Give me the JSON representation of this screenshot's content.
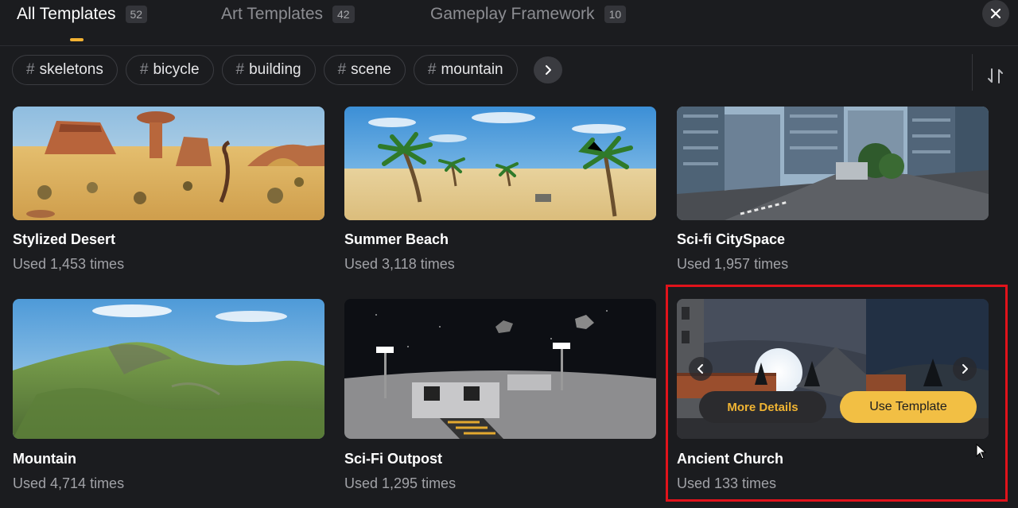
{
  "tabs": [
    {
      "label": "All Templates",
      "count": "52",
      "active": true
    },
    {
      "label": "Art Templates",
      "count": "42",
      "active": false
    },
    {
      "label": "Gameplay Framework",
      "count": "10",
      "active": false
    }
  ],
  "accent_color": "#f2b233",
  "tags": [
    {
      "hash": "#",
      "label": "skeletons"
    },
    {
      "hash": "#",
      "label": "bicycle"
    },
    {
      "hash": "#",
      "label": "building"
    },
    {
      "hash": "#",
      "label": "scene"
    },
    {
      "hash": "#",
      "label": "mountain"
    }
  ],
  "icons": {
    "close": "close-icon",
    "tags_next": "chevron-right-icon",
    "sort": "sort-icon",
    "carousel_prev": "chevron-left-icon",
    "carousel_next": "chevron-right-icon"
  },
  "templates": [
    {
      "title": "Stylized Desert",
      "usage": "Used 1,453 times"
    },
    {
      "title": "Summer Beach",
      "usage": "Used 3,118 times"
    },
    {
      "title": "Sci-fi CitySpace",
      "usage": "Used 1,957 times"
    },
    {
      "title": "Mountain",
      "usage": "Used 4,714 times"
    },
    {
      "title": "Sci-Fi Outpost",
      "usage": "Used 1,295 times"
    },
    {
      "title": "Ancient Church",
      "usage": "Used 133 times"
    }
  ],
  "hover_card": {
    "more_details": "More Details",
    "use_template": "Use Template",
    "highlight_color": "#e1131b"
  }
}
